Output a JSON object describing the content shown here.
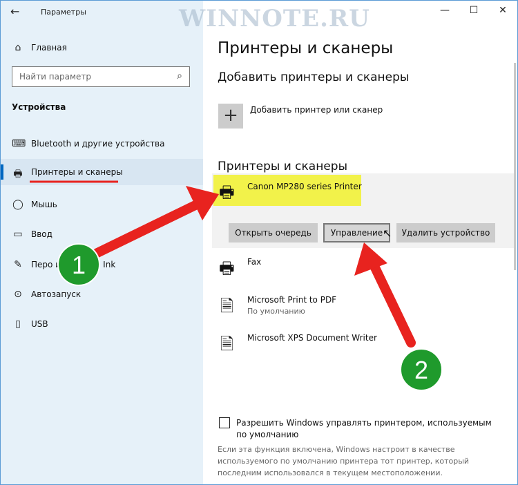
{
  "app": {
    "title": "Параметры",
    "back_glyph": "←",
    "minimize_glyph": "—",
    "maximize_glyph": "☐",
    "close_glyph": "✕"
  },
  "watermark": "WINNOTE.RU",
  "sidebar": {
    "home": "Главная",
    "search_placeholder": "Найти параметр",
    "section": "Устройства",
    "items": [
      {
        "label": "Bluetooth и другие устройства",
        "icon": "devices-icon",
        "glyph": "⌨"
      },
      {
        "label": "Принтеры и сканеры",
        "icon": "printer-icon",
        "glyph": "🖶",
        "active": true
      },
      {
        "label": "Мышь",
        "icon": "mouse-icon",
        "glyph": "◯"
      },
      {
        "label": "Ввод",
        "icon": "keyboard-icon",
        "glyph": "▭"
      },
      {
        "label": "Перо и Windows Ink",
        "icon": "pen-icon",
        "glyph": "✎"
      },
      {
        "label": "Автозапуск",
        "icon": "autoplay-icon",
        "glyph": "⊙"
      },
      {
        "label": "USB",
        "icon": "usb-icon",
        "glyph": "▯"
      }
    ]
  },
  "main": {
    "title": "Принтеры и сканеры",
    "add_heading": "Добавить принтеры и сканеры",
    "add_label": "Добавить принтер или сканер",
    "list_heading": "Принтеры и сканеры",
    "printers": [
      {
        "name": "Canon MP280 series Printer",
        "sub": "",
        "icon": "printer-icon"
      },
      {
        "name": "Fax",
        "sub": "",
        "icon": "fax-icon"
      },
      {
        "name": "Microsoft Print to PDF",
        "sub": "По умолчанию",
        "icon": "document-printer-icon"
      },
      {
        "name": "Microsoft XPS Document Writer",
        "sub": "",
        "icon": "document-printer-icon"
      }
    ],
    "buttons": {
      "open_queue": "Открыть очередь",
      "manage": "Управление",
      "remove": "Удалить устройство"
    },
    "checkbox_label": "Разрешить Windows управлять принтером, используемым по умолчанию",
    "description": "Если эта функция включена, Windows настроит в качестве используемого по умолчанию принтера тот принтер, который последним использовался в текущем местоположении."
  },
  "annotations": {
    "step1": "1",
    "step2": "2",
    "arrow_color": "#e8231f",
    "circle_color": "#1f9a2c",
    "highlight_color": "#f2f24a"
  }
}
